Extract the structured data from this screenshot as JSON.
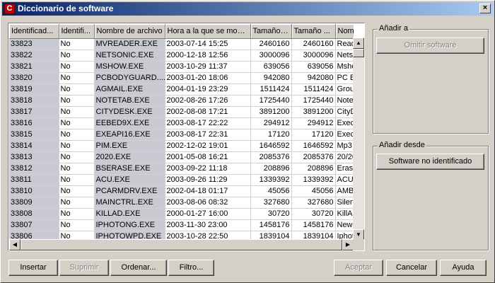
{
  "window": {
    "title": "Diccionario de software",
    "close_glyph": "×",
    "icon_glyph": "C"
  },
  "table": {
    "columns": [
      "Identificad...",
      "Identifi...",
      "Nombre de archivo",
      "Hora a la que se modi...",
      "Tamaño ...",
      "Tamaño ...",
      "Nom"
    ],
    "rows": [
      [
        "33823",
        "No",
        "MVREADER.EXE",
        "2003-07-14 15:25",
        "2460160",
        "2460160",
        "Read"
      ],
      [
        "33822",
        "No",
        "NETSONIC.EXE",
        "2000-12-18 12:56",
        "3000096",
        "3000096",
        "Netso"
      ],
      [
        "33821",
        "No",
        "MSHOW.EXE",
        "2003-10-29 11:37",
        "639056",
        "639056",
        "Msho"
      ],
      [
        "33820",
        "No",
        "PCBODYGUARD....",
        "2003-01-20 18:06",
        "942080",
        "942080",
        "PC Bo"
      ],
      [
        "33819",
        "No",
        "AGMAIL.EXE",
        "2004-01-19 23:29",
        "1511424",
        "1511424",
        "Group"
      ],
      [
        "33818",
        "No",
        "NOTETAB.EXE",
        "2002-08-26 17:26",
        "1725440",
        "1725440",
        "NoteT"
      ],
      [
        "33817",
        "No",
        "CITYDESK.EXE",
        "2002-08-08 17:21",
        "3891200",
        "3891200",
        "CityD"
      ],
      [
        "33816",
        "No",
        "EEBED9X.EXE",
        "2003-08-17 22:22",
        "294912",
        "294912",
        "Exec"
      ],
      [
        "33815",
        "No",
        "EXEAPI16.EXE",
        "2003-08-17 22:31",
        "17120",
        "17120",
        "Exec"
      ],
      [
        "33814",
        "No",
        "PIM.EXE",
        "2002-12-02 19:01",
        "1646592",
        "1646592",
        "Mp3 F"
      ],
      [
        "33813",
        "No",
        "2020.EXE",
        "2001-05-08 16:21",
        "2085376",
        "2085376",
        "20/20"
      ],
      [
        "33812",
        "No",
        "BSERASE.EXE",
        "2003-09-22 11:18",
        "208896",
        "208896",
        "Erase"
      ],
      [
        "33811",
        "No",
        "ACU.EXE",
        "2003-09-26 11:29",
        "1339392",
        "1339392",
        "ACU"
      ],
      [
        "33810",
        "No",
        "PCARMDRV.EXE",
        "2002-04-18 01:17",
        "45056",
        "45056",
        "AMBI"
      ],
      [
        "33809",
        "No",
        "MAINCTRL.EXE",
        "2003-08-06 08:32",
        "327680",
        "327680",
        "Silen"
      ],
      [
        "33808",
        "No",
        "KILLAD.EXE",
        "2000-01-27 16:00",
        "30720",
        "30720",
        "KillAc"
      ],
      [
        "33807",
        "No",
        "IPHOTONG.EXE",
        "2003-11-30 23:00",
        "1458176",
        "1458176",
        "News"
      ],
      [
        "33806",
        "No",
        "IPHOTOWPD.EXE",
        "2003-10-28 22:50",
        "1839104",
        "1839104",
        "Iphoto"
      ]
    ]
  },
  "add_to": {
    "label": "Añadir a",
    "omit_button": "Omitir software"
  },
  "add_from": {
    "label": "Añadir desde",
    "unidentified_button": "Software no identificado"
  },
  "buttons": {
    "insert": "Insertar",
    "delete": "Suprimir",
    "sort": "Ordenar...",
    "filter": "Filtro...",
    "accept": "Aceptar",
    "cancel": "Cancelar",
    "help": "Ayuda"
  },
  "scroll": {
    "up": "▲",
    "down": "▼",
    "left": "◀",
    "right": "▶"
  }
}
